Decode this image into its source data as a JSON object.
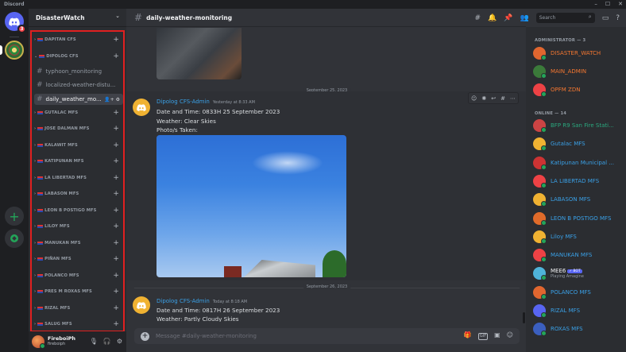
{
  "window": {
    "app_name": "Discord",
    "controls": [
      "–",
      "☐",
      "✕"
    ]
  },
  "guilds": {
    "home_badge": "3"
  },
  "server": {
    "name": "DisasterWatch"
  },
  "categories": [
    {
      "name": "DAPITAN CFS",
      "expanded": false
    },
    {
      "name": "DIPOLOG CFS",
      "expanded": true
    },
    {
      "name": "GUTALAC MFS",
      "expanded": false
    },
    {
      "name": "JOSE DALMAN MFS",
      "expanded": false
    },
    {
      "name": "KALAWIT MFS",
      "expanded": false
    },
    {
      "name": "KATIPUNAN MFS",
      "expanded": false
    },
    {
      "name": "LA LIBERTAD MFS",
      "expanded": false
    },
    {
      "name": "LABASON MFS",
      "expanded": false
    },
    {
      "name": "LEON B POSTIGO MFS",
      "expanded": false
    },
    {
      "name": "LILOY MFS",
      "expanded": false
    },
    {
      "name": "MANUKAN MFS",
      "expanded": false
    },
    {
      "name": "PIÑAN MFS",
      "expanded": false
    },
    {
      "name": "POLANCO MFS",
      "expanded": false
    },
    {
      "name": "PRES M ROXAS MFS",
      "expanded": false
    },
    {
      "name": "RIZAL MFS",
      "expanded": false
    },
    {
      "name": "SALUG MFS",
      "expanded": false
    }
  ],
  "channels": [
    {
      "name": "typhoon_monitoring"
    },
    {
      "name": "localized-weather-distu..."
    },
    {
      "name": "daily_weather_mo...",
      "active": true
    }
  ],
  "user": {
    "name": "FireboiPh",
    "tag": "fireboiph"
  },
  "channel_header": {
    "title": "daily-weather-monitoring"
  },
  "header_tools": {
    "search_placeholder": "Search"
  },
  "messages": [
    {
      "date_divider": "September 25, 2023",
      "author": "Dipolog CFS-Admin",
      "timestamp": "Yesterday at 8:33 AM",
      "lines": [
        "Date and Time: 0833H 25 September 2023",
        "Weather: Clear Skies",
        "Photo/s Taken:"
      ]
    },
    {
      "date_divider": "September 26, 2023",
      "author": "Dipolog CFS-Admin",
      "timestamp": "Today at 8:18 AM",
      "lines": [
        "Date and Time: 0817H 26 September 2023",
        "Weather: Partly Cloudy Skies"
      ]
    }
  ],
  "composer": {
    "placeholder": "Message #daily-weather-monitoring",
    "gif_label": "GIF"
  },
  "members": {
    "admin_header": "ADMINISTRATOR — 3",
    "online_header": "ONLINE — 14",
    "admins": [
      {
        "name": "DISASTER_WATCH",
        "color": "#f57731",
        "avatar": "#e0662f"
      },
      {
        "name": "MAIN_ADMIN",
        "color": "#f57731",
        "avatar": "#3b7a3a"
      },
      {
        "name": "OPFM ZDN",
        "color": "#f57731",
        "avatar": "#ed4245"
      }
    ],
    "online": [
      {
        "name": "BFP R9 San Fire Stati...",
        "color": "#2aa87e",
        "avatar": "#c44"
      },
      {
        "name": "Gutalac MFS",
        "color": "#3aa0e6",
        "avatar": "#f0b232"
      },
      {
        "name": "Katipunan Municipal ...",
        "color": "#3aa0e6",
        "avatar": "#c33"
      },
      {
        "name": "LA LIBERTAD MFS",
        "color": "#3aa0e6",
        "avatar": "#ed4245"
      },
      {
        "name": "LABASON MFS",
        "color": "#3aa0e6",
        "avatar": "#f0b232"
      },
      {
        "name": "LEON B POSTIGO MFS",
        "color": "#3aa0e6",
        "avatar": "#e06b2a"
      },
      {
        "name": "Liloy MFS",
        "color": "#3aa0e6",
        "avatar": "#f0b232"
      },
      {
        "name": "MANUKAN MFS",
        "color": "#3aa0e6",
        "avatar": "#ed4245"
      },
      {
        "name": "MEE6",
        "color": "#f2f3f5",
        "avatar": "#4fb3d9",
        "bot": "✓ BOT",
        "status": "Playing Amagine"
      },
      {
        "name": "POLANCO MFS",
        "color": "#3aa0e6",
        "avatar": "#e0662f"
      },
      {
        "name": "RIZAL MFS",
        "color": "#3aa0e6",
        "avatar": "#5865f2"
      },
      {
        "name": "ROXAS MFS",
        "color": "#3aa0e6",
        "avatar": "#3b5fbf"
      }
    ]
  }
}
